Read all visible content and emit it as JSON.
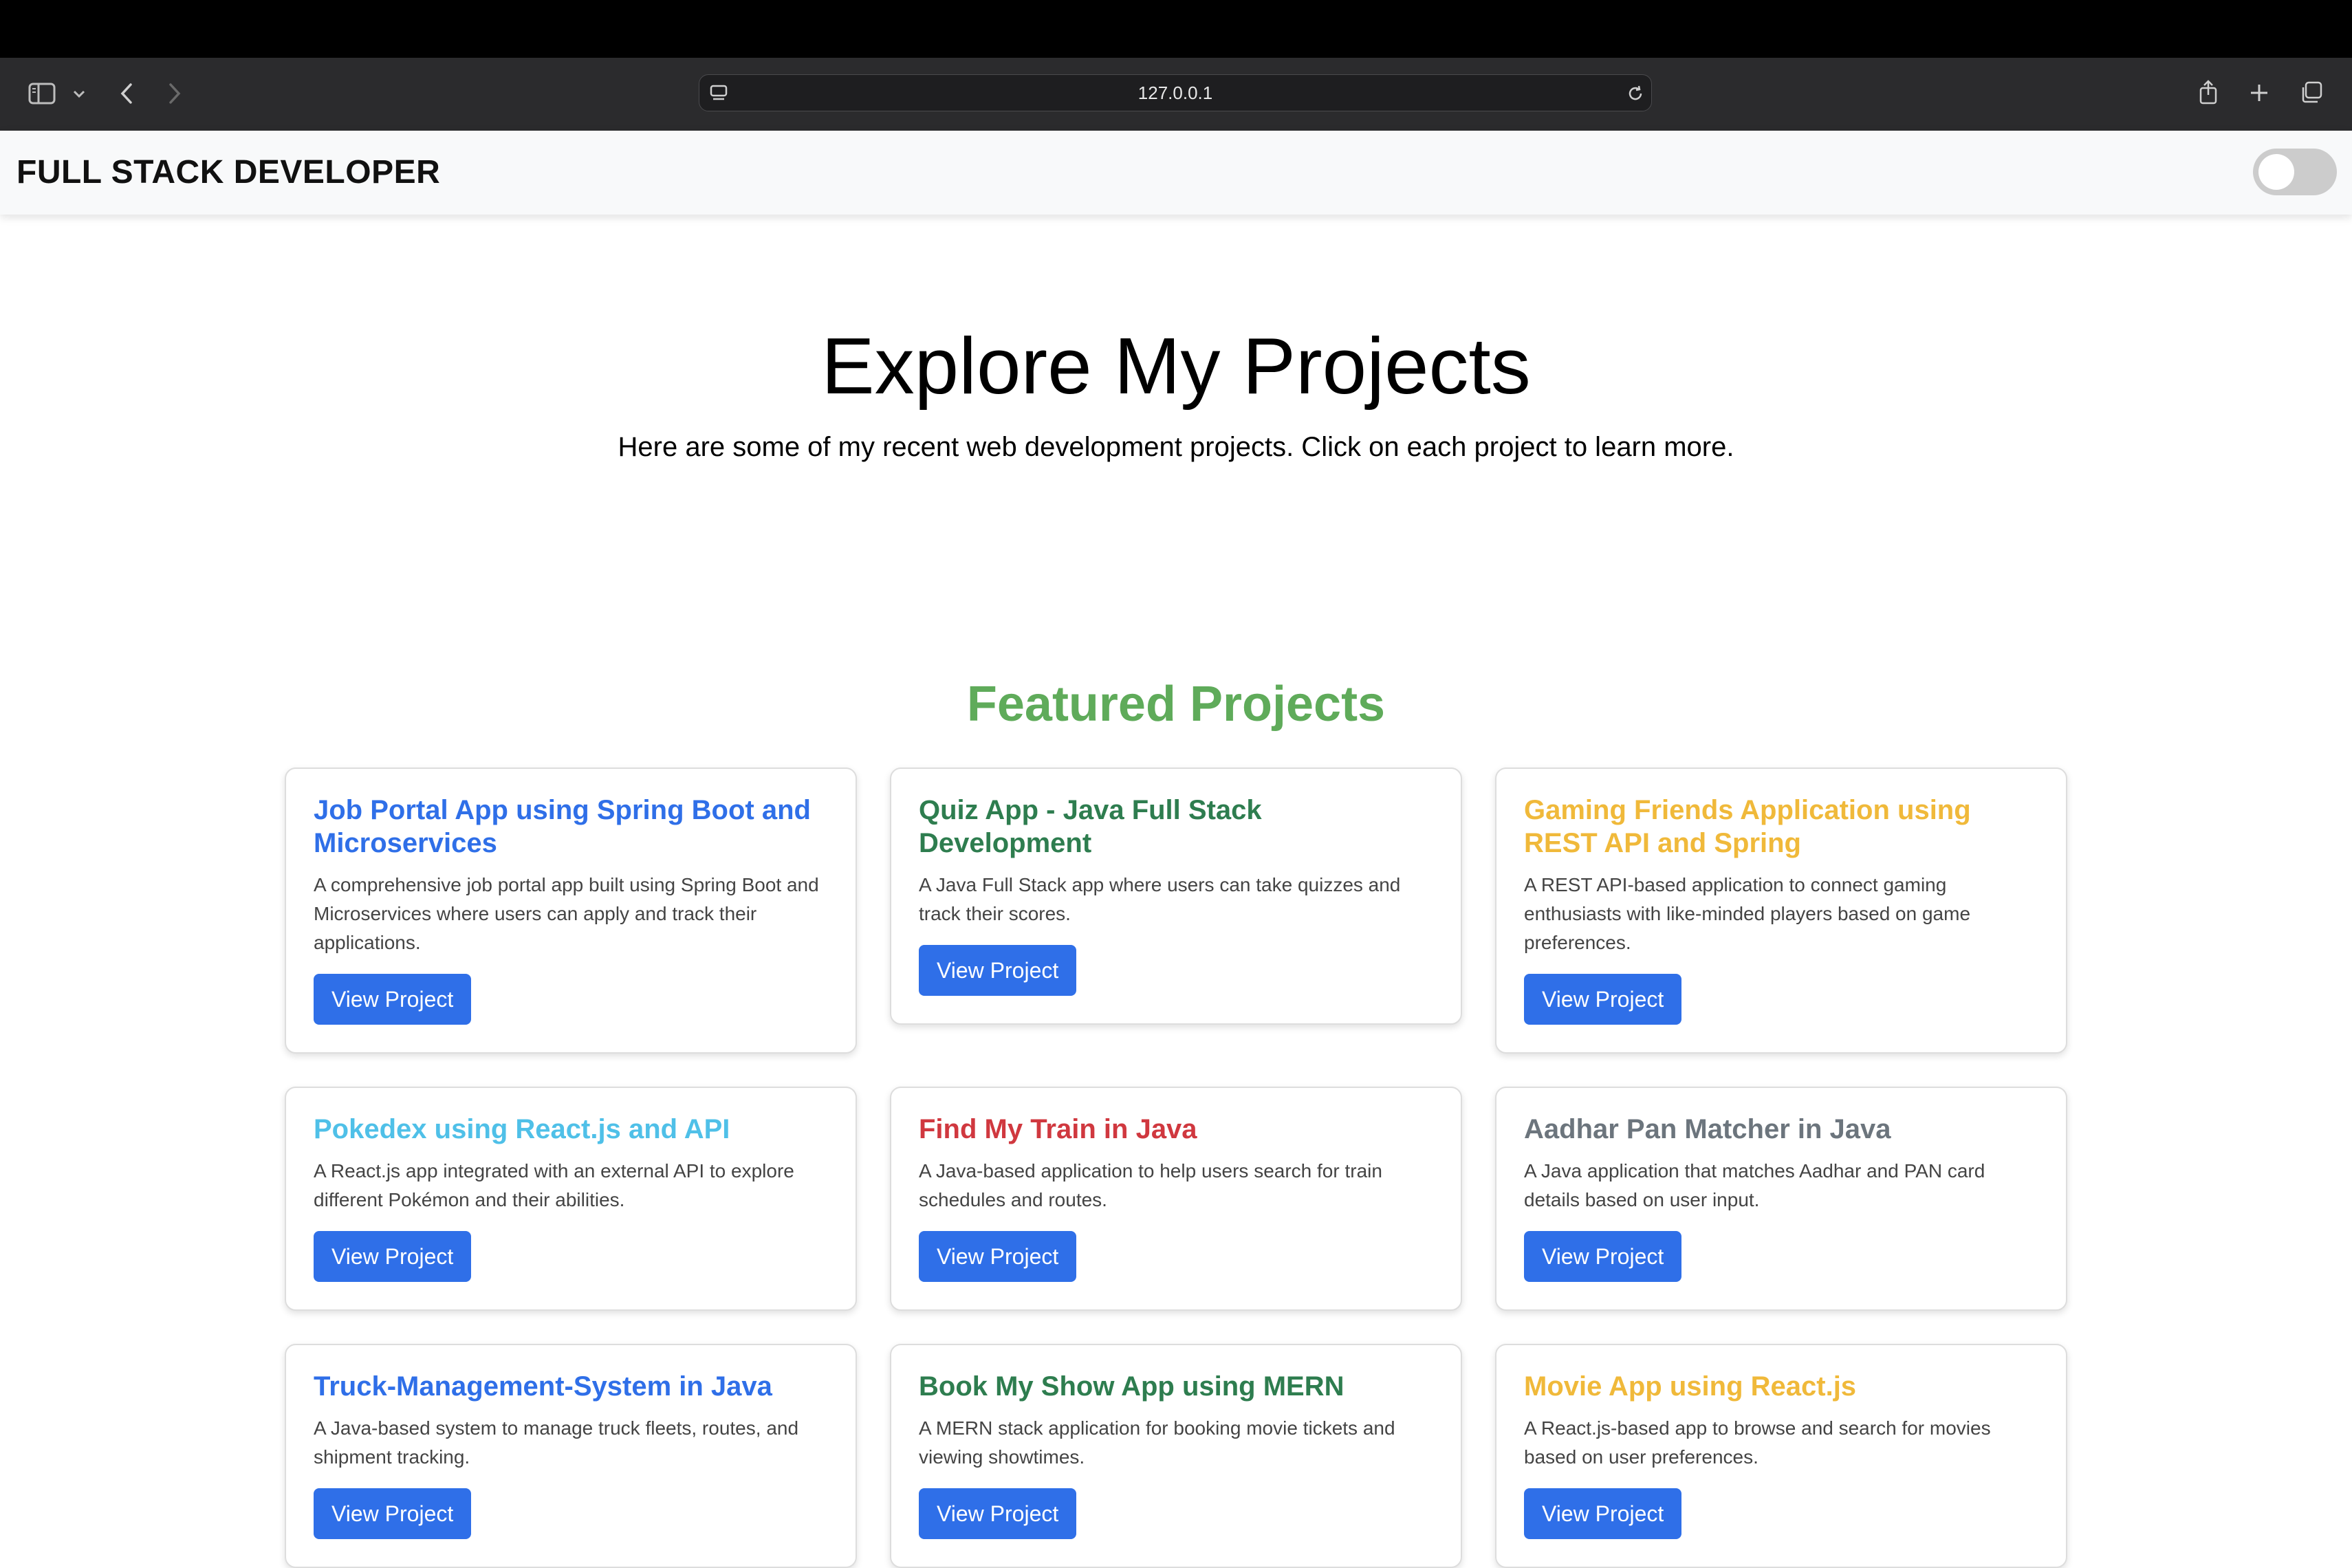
{
  "browser": {
    "url": "127.0.0.1"
  },
  "header": {
    "brand": "FULL STACK DEVELOPER"
  },
  "hero": {
    "title": "Explore My Projects",
    "subtitle": "Here are some of my recent web development projects. Click on each project to learn more."
  },
  "featured": {
    "title": "Featured Projects",
    "button_label": "View Project",
    "projects": [
      {
        "title": "Job Portal App using Spring Boot and Microservices",
        "description": "A comprehensive job portal app built using Spring Boot and Microservices where users can apply and track their applications.",
        "color": "#2f6fe8"
      },
      {
        "title": "Quiz App - Java Full Stack Development",
        "description": "A Java Full Stack app where users can take quizzes and track their scores.",
        "color": "#2e7d4f"
      },
      {
        "title": "Gaming Friends Application using REST API and Spring",
        "description": "A REST API-based application to connect gaming enthusiasts with like-minded players based on game preferences.",
        "color": "#f0b93a"
      },
      {
        "title": "Pokedex using React.js and API",
        "description": "A React.js app integrated with an external API to explore different Pokémon and their abilities.",
        "color": "#4fc0e8"
      },
      {
        "title": "Find My Train in Java",
        "description": "A Java-based application to help users search for train schedules and routes.",
        "color": "#d0383f"
      },
      {
        "title": "Aadhar Pan Matcher in Java",
        "description": "A Java application that matches Aadhar and PAN card details based on user input.",
        "color": "#6c757d"
      },
      {
        "title": "Truck-Management-System in Java",
        "description": "A Java-based system to manage truck fleets, routes, and shipment tracking.",
        "color": "#2f6fe8"
      },
      {
        "title": "Book My Show App using MERN",
        "description": "A MERN stack application for booking movie tickets and viewing showtimes.",
        "color": "#2e7d4f"
      },
      {
        "title": "Movie App using React.js",
        "description": "A React.js-based app to browse and search for movies based on user preferences.",
        "color": "#f0b93a"
      }
    ]
  }
}
